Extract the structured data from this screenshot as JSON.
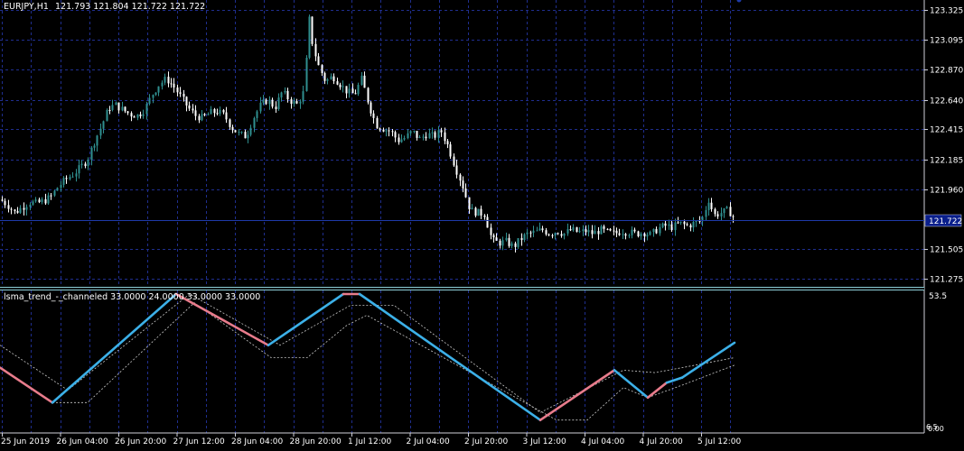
{
  "window": {
    "symbol_label": "EURJPY,H1",
    "ohlc_label": "121.793 121.804 121.722 121.722"
  },
  "indicator": {
    "label": "lsma_trend_-_channeled 33.0000 24.0000 33.0000 33.0000",
    "scale_top": "53.5",
    "scale_bottom": "0.00",
    "scale_bottom_overlap": "6.5"
  },
  "colors": {
    "background": "#000000",
    "grid": "#1f2e8f",
    "axis": "#cfd0d8",
    "candle_up": "#2f8f8f",
    "candle_down": "#ffffff",
    "current_price_line": "#1e3aa8",
    "current_price_tag": "#0a1f8c",
    "trend_up": "#3cb0e8",
    "trend_down": "#e87c8c",
    "channel": "#c8c8c8",
    "separator": "#8ecfd8"
  },
  "chart_data": [
    {
      "type": "candlestick",
      "symbol": "EURJPY",
      "timeframe": "H1",
      "ylim": [
        121.215,
        123.4
      ],
      "y_ticks": [
        "123.325",
        "123.095",
        "122.870",
        "122.640",
        "122.415",
        "122.185",
        "121.960",
        "121.505",
        "121.275"
      ],
      "current_price": "121.722",
      "x_ticks": [
        "25 Jun 2019",
        "26 Jun 04:00",
        "26 Jun 20:00",
        "27 Jun 12:00",
        "28 Jun 04:00",
        "28 Jun 20:00",
        "1 Jul 12:00",
        "2 Jul 04:00",
        "2 Jul 20:00",
        "3 Jul 12:00",
        "4 Jul 04:00",
        "4 Jul 20:00",
        "5 Jul 12:00"
      ],
      "close_path": [
        [
          0,
          121.88
        ],
        [
          8,
          121.84
        ],
        [
          16,
          121.78
        ],
        [
          24,
          121.82
        ],
        [
          32,
          121.86
        ],
        [
          40,
          121.85
        ],
        [
          48,
          121.87
        ],
        [
          56,
          121.9
        ],
        [
          64,
          121.98
        ],
        [
          72,
          122.03
        ],
        [
          80,
          122.07
        ],
        [
          88,
          122.12
        ],
        [
          96,
          122.18
        ],
        [
          104,
          122.32
        ],
        [
          112,
          122.44
        ],
        [
          120,
          122.58
        ],
        [
          128,
          122.6
        ],
        [
          136,
          122.56
        ],
        [
          144,
          122.53
        ],
        [
          152,
          122.52
        ],
        [
          160,
          122.57
        ],
        [
          168,
          122.68
        ],
        [
          176,
          122.76
        ],
        [
          184,
          122.8
        ],
        [
          192,
          122.74
        ],
        [
          200,
          122.66
        ],
        [
          208,
          122.58
        ],
        [
          216,
          122.52
        ],
        [
          224,
          122.5
        ],
        [
          232,
          122.54
        ],
        [
          240,
          122.55
        ],
        [
          248,
          122.52
        ],
        [
          256,
          122.43
        ],
        [
          264,
          122.38
        ],
        [
          272,
          122.36
        ],
        [
          280,
          122.5
        ],
        [
          288,
          122.6
        ],
        [
          296,
          122.64
        ],
        [
          304,
          122.58
        ],
        [
          312,
          122.7
        ],
        [
          320,
          122.64
        ],
        [
          328,
          122.6
        ],
        [
          336,
          122.7
        ],
        [
          342,
          123.25
        ],
        [
          346,
          123.05
        ],
        [
          352,
          122.9
        ],
        [
          360,
          122.78
        ],
        [
          368,
          122.82
        ],
        [
          376,
          122.76
        ],
        [
          384,
          122.7
        ],
        [
          392,
          122.68
        ],
        [
          400,
          122.8
        ],
        [
          408,
          122.6
        ],
        [
          416,
          122.45
        ],
        [
          424,
          122.42
        ],
        [
          432,
          122.4
        ],
        [
          440,
          122.33
        ],
        [
          448,
          122.35
        ],
        [
          456,
          122.4
        ],
        [
          464,
          122.34
        ],
        [
          472,
          122.38
        ],
        [
          480,
          122.36
        ],
        [
          488,
          122.4
        ],
        [
          496,
          122.28
        ],
        [
          504,
          122.12
        ],
        [
          512,
          121.98
        ],
        [
          520,
          121.8
        ],
        [
          528,
          121.78
        ],
        [
          536,
          121.77
        ],
        [
          544,
          121.57
        ],
        [
          552,
          121.55
        ],
        [
          560,
          121.56
        ],
        [
          568,
          121.52
        ],
        [
          576,
          121.58
        ],
        [
          584,
          121.62
        ],
        [
          592,
          121.63
        ],
        [
          600,
          121.65
        ],
        [
          608,
          121.62
        ],
        [
          616,
          121.64
        ],
        [
          624,
          121.62
        ],
        [
          632,
          121.65
        ],
        [
          640,
          121.63
        ],
        [
          648,
          121.64
        ],
        [
          656,
          121.62
        ],
        [
          664,
          121.65
        ],
        [
          672,
          121.63
        ],
        [
          680,
          121.62
        ],
        [
          688,
          121.64
        ],
        [
          696,
          121.63
        ],
        [
          704,
          121.62
        ],
        [
          712,
          121.63
        ],
        [
          720,
          121.61
        ],
        [
          728,
          121.66
        ],
        [
          736,
          121.68
        ],
        [
          744,
          121.67
        ],
        [
          752,
          121.7
        ],
        [
          760,
          121.68
        ],
        [
          768,
          121.7
        ],
        [
          776,
          121.72
        ],
        [
          784,
          121.88
        ],
        [
          790,
          121.76
        ],
        [
          798,
          121.78
        ],
        [
          806,
          121.8
        ],
        [
          814,
          121.72
        ]
      ]
    },
    {
      "type": "line",
      "name": "lsma_trend_-_channeled",
      "ylim": [
        0,
        53.5
      ],
      "trend_path": [
        [
          0,
          24
        ],
        [
          58,
          10
        ],
        [
          195,
          53.5
        ],
        [
          297,
          33
        ],
        [
          380,
          53.5
        ],
        [
          398,
          53.5
        ],
        [
          598,
          3
        ],
        [
          680,
          23
        ],
        [
          717,
          12
        ],
        [
          738,
          18
        ],
        [
          755,
          20
        ],
        [
          813,
          34
        ]
      ],
      "trend_color_sequence": [
        "down",
        "up",
        "down",
        "up",
        "down",
        "up",
        "down",
        "up",
        "down",
        "up"
      ],
      "upper_channel": [
        [
          0,
          33
        ],
        [
          75,
          15
        ],
        [
          210,
          53.5
        ],
        [
          310,
          33
        ],
        [
          388,
          49
        ],
        [
          436,
          49
        ],
        [
          598,
          6
        ],
        [
          690,
          23
        ],
        [
          725,
          22
        ],
        [
          755,
          24
        ],
        [
          813,
          28
        ]
      ],
      "lower_channel": [
        [
          58,
          10
        ],
        [
          97,
          10
        ],
        [
          215,
          50
        ],
        [
          300,
          28
        ],
        [
          340,
          28
        ],
        [
          384,
          41
        ],
        [
          406,
          45
        ],
        [
          616,
          3
        ],
        [
          650,
          3
        ],
        [
          690,
          16
        ],
        [
          717,
          12
        ],
        [
          755,
          17
        ],
        [
          813,
          25
        ]
      ]
    }
  ]
}
